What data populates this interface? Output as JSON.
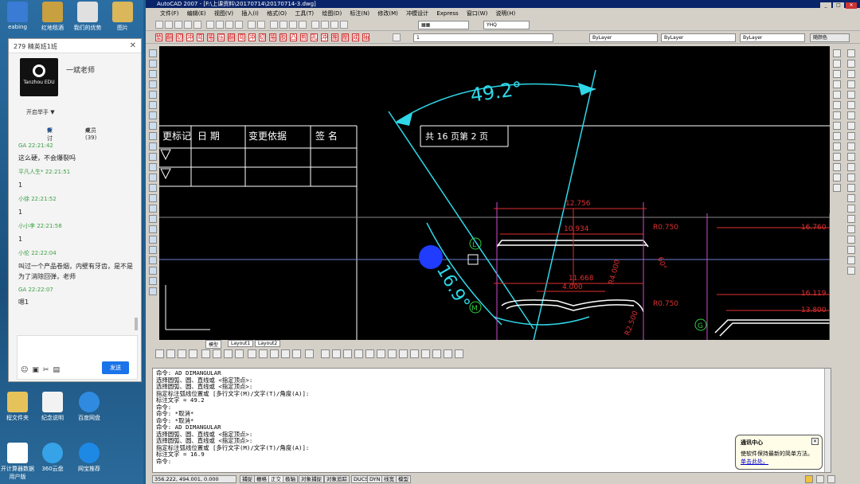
{
  "desktop": {
    "icons_top": [
      "eabing",
      "红地毯酒",
      "我们的优势",
      "图片"
    ],
    "icons_bottom": [
      "程文件夹",
      "纪念说明",
      "百度网盘",
      "开计算器数据用户版",
      "360云盘",
      "网宝推荐"
    ]
  },
  "chat": {
    "title": "279 精英班1班",
    "teacher": "一斌老师",
    "logo_text": "Tanzhou EDU",
    "raise_hand": "开启举手 ▼",
    "tab_discuss": "探讨",
    "tab_members": "成员 (39)",
    "messages": [
      {
        "who": "GA  22:21:42",
        "text": "这么硬，不会爆裂吗"
      },
      {
        "who": "平凡人生*  22:21:51",
        "text": "1"
      },
      {
        "who": "小徐  22:21:52",
        "text": "1"
      },
      {
        "who": "小小李  22:21:58",
        "text": "1"
      },
      {
        "who": "小伦  22:22:04",
        "text": "叫过一个产品卷烟，内壁有牙齿，是不是为了消除回弹，老师"
      },
      {
        "who": "GA  22:22:07",
        "text": "嗯1"
      }
    ],
    "send": "发送"
  },
  "acad": {
    "title": "AutoCAD 2007 - [F:\\上课资料\\20170714\\20170714-3.dwg]",
    "menu": [
      "文件(F)",
      "编辑(E)",
      "视图(V)",
      "插入(I)",
      "格式(O)",
      "工具(T)",
      "绘图(D)",
      "标注(N)",
      "修改(M)",
      "冲模设计",
      "Express",
      "窗口(W)",
      "说明(H)"
    ],
    "combo_style": "▦▦",
    "combo_font": "YHQ",
    "combo_layer": "1",
    "combo_color": "ByLayer",
    "combo_linetype": "ByLayer",
    "combo_lineweight": "ByLayer",
    "combo_plot": "随颜色",
    "red_tools": [
      "垫",
      "翻",
      "切",
      "冲",
      "弯",
      "捲",
      "压",
      "翻",
      "弯",
      "冲",
      "切",
      "捲",
      "胶",
      "凸",
      "剪",
      "孔",
      "冲",
      "推",
      "壓",
      "成",
      "抽"
    ],
    "layout_tabs": [
      "模型",
      "Layout1",
      "Layout2"
    ],
    "drawing": {
      "angle_top": "49.2°",
      "angle_left": "16.9°",
      "tb_col1": "更标记",
      "tb_col2": "日  期",
      "tb_col3": "变更依据",
      "tb_col4": "签  名",
      "sheet": "共 16 页第 2 页",
      "dims": [
        "12.756",
        "10.934",
        "11.668",
        "4.000",
        "R0.750",
        "R0.750",
        "R4.000",
        "R2.500",
        "16.760",
        "16.119",
        "13.800",
        "60°"
      ],
      "markers": [
        "L",
        "M",
        "G"
      ]
    },
    "command_lines": [
      "命令: AD DIMANGULAR",
      "选择圆弧、圆、直线或 <指定顶点>:",
      "选择圆弧、圆、直线或 <指定顶点>:",
      "指定标注弧线位置或 [多行文字(M)/文字(T)/角度(A)]:",
      "标注文字 = 49.2",
      "命令:",
      "命令: *取消*",
      "命令: *取消*",
      "命令: AD DIMANGULAR",
      "选择圆弧、圆、直线或 <指定顶点>:",
      "选择圆弧、圆、直线或 <指定顶点>:",
      "指定标注弧线位置或 [多行文字(M)/文字(T)/角度(A)]:",
      "标注文字 = 16.9",
      "命令:"
    ],
    "status": {
      "coords": "356.222, 494.001, 0.000",
      "toggles": [
        "捕捉",
        "栅格",
        "正交",
        "极轴",
        "对象捕捉",
        "对象追踪",
        "DUCS",
        "DYN",
        "线宽",
        "模型"
      ]
    },
    "balloon": {
      "title": "通讯中心",
      "text": "使软件保持最新的简单方法。",
      "link": "单击此处。"
    }
  }
}
